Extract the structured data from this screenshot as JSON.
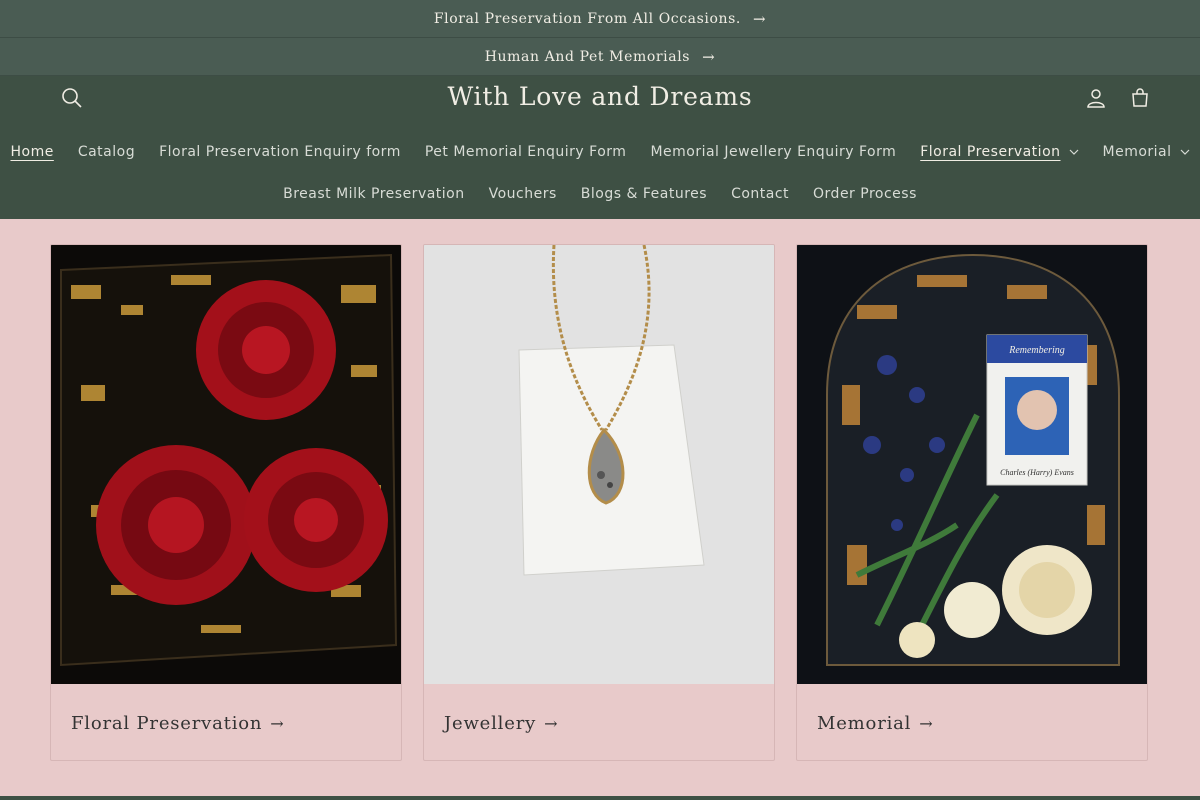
{
  "announcements": [
    {
      "text": "Floral Preservation From All Occasions.",
      "arrow": "→"
    },
    {
      "text": "Human And Pet Memorials",
      "arrow": "→"
    }
  ],
  "header": {
    "logo": "With Love and Dreams",
    "icons": [
      "search-icon",
      "account-icon",
      "cart-icon"
    ]
  },
  "nav": {
    "row1": [
      {
        "label": "Home",
        "active": true
      },
      {
        "label": "Catalog"
      },
      {
        "label": "Floral Preservation Enquiry form"
      },
      {
        "label": "Pet Memorial Enquiry Form"
      },
      {
        "label": "Memorial Jewellery Enquiry Form"
      },
      {
        "label": "Floral Preservation",
        "dropdown": true,
        "active": true
      },
      {
        "label": "Memorial",
        "dropdown": true
      }
    ],
    "row2": [
      {
        "label": "Breast Milk Preservation"
      },
      {
        "label": "Vouchers"
      },
      {
        "label": "Blogs & Features"
      },
      {
        "label": "Contact"
      },
      {
        "label": "Order Process"
      }
    ]
  },
  "collections": [
    {
      "title": "Floral Preservation",
      "arrow": "→"
    },
    {
      "title": "Jewellery",
      "arrow": "→"
    },
    {
      "title": "Memorial",
      "arrow": "→"
    }
  ],
  "memorial_image_text": {
    "banner": "Remembering",
    "caption": "Charles (Harry) Evans"
  },
  "colors": {
    "announcement_bg": "#4a5c53",
    "header_bg": "#3e5044",
    "page_bg": "#e8caca"
  }
}
